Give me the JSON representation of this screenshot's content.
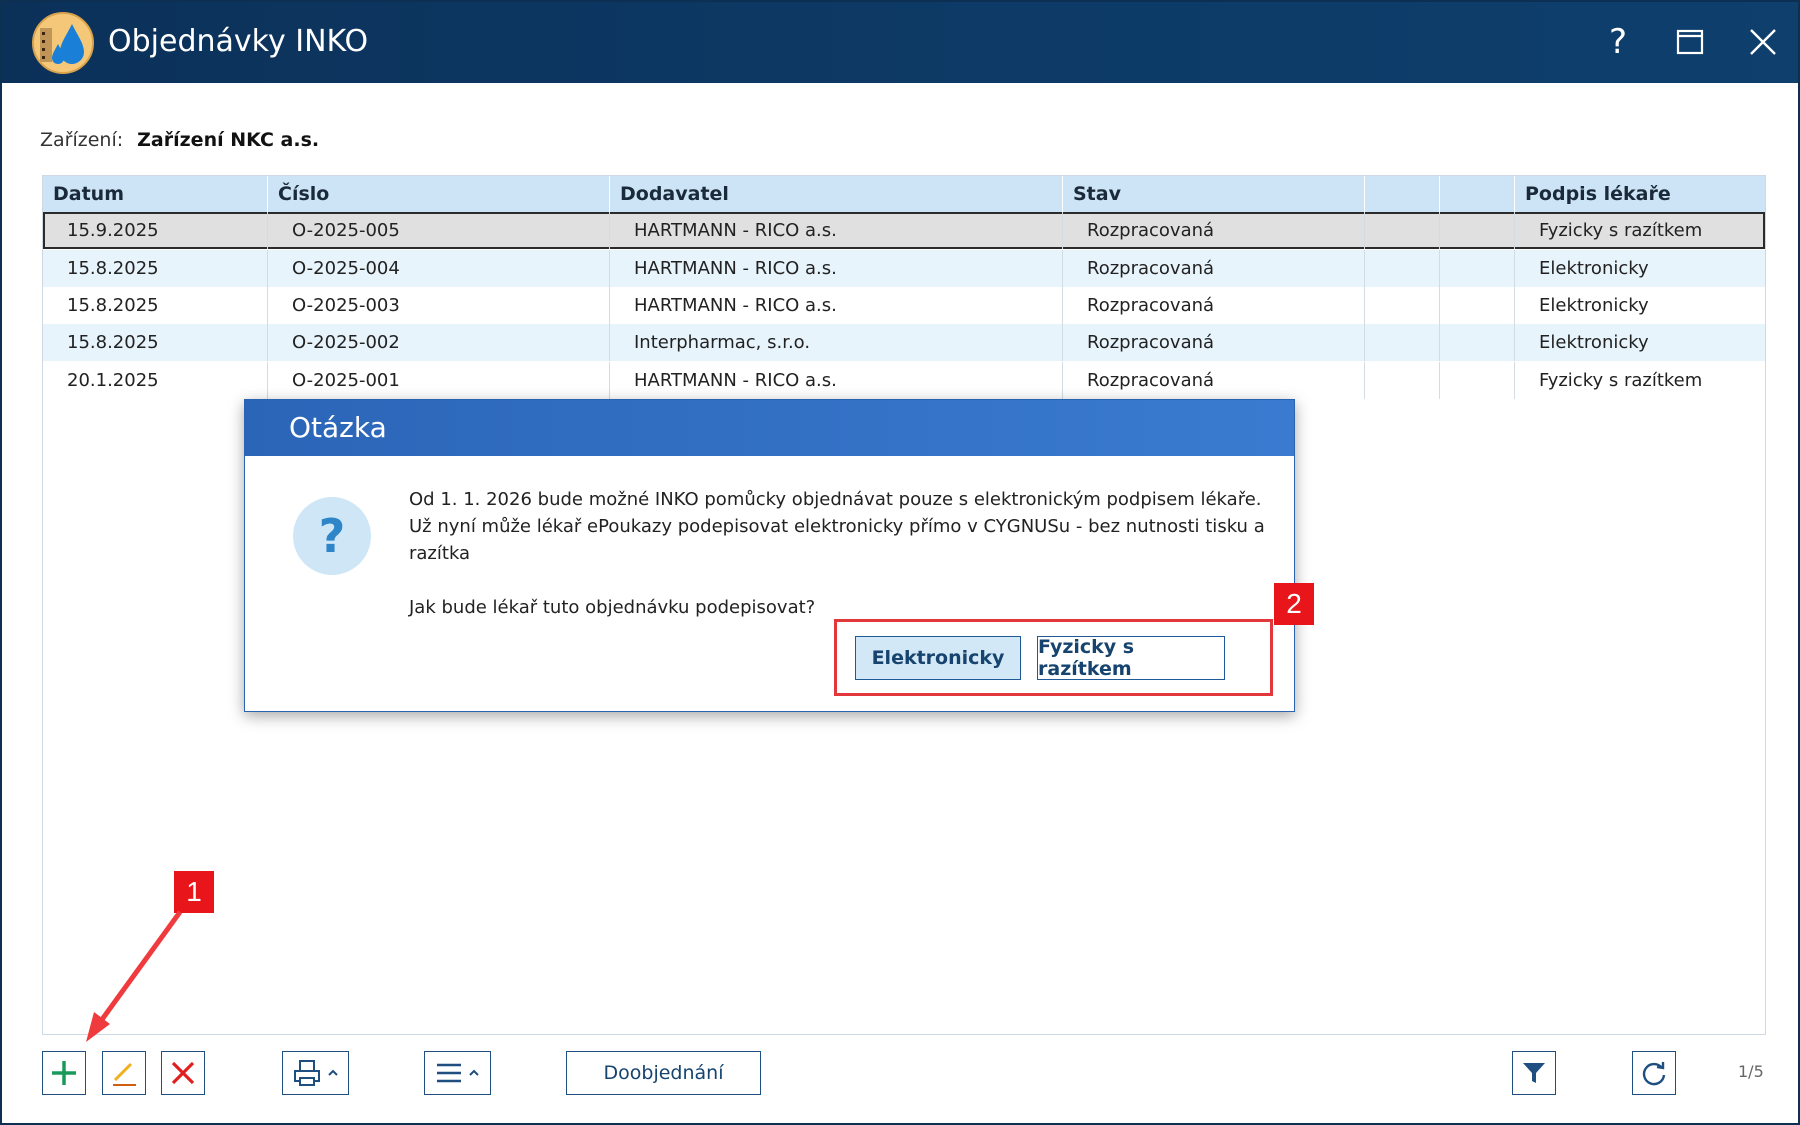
{
  "window": {
    "title": "Objednávky INKO",
    "logo_icon": "drops-app-icon",
    "help_label": "?"
  },
  "facility": {
    "label": "Zařízení:",
    "value": "Zařízení NKC a.s."
  },
  "grid": {
    "columns": [
      "Datum",
      "Číslo",
      "Dodavatel",
      "Stav",
      "",
      "",
      "Podpis lékaře"
    ],
    "rows": [
      {
        "datum": "15.9.2025",
        "cislo": "O-2025-005",
        "dodavatel": "HARTMANN - RICO a.s.",
        "stav": "Rozpracovaná",
        "podpis": "Fyzicky s razítkem",
        "selected": true
      },
      {
        "datum": "15.8.2025",
        "cislo": "O-2025-004",
        "dodavatel": "HARTMANN - RICO a.s.",
        "stav": "Rozpracovaná",
        "podpis": "Elektronicky"
      },
      {
        "datum": "15.8.2025",
        "cislo": "O-2025-003",
        "dodavatel": "HARTMANN - RICO a.s.",
        "stav": "Rozpracovaná",
        "podpis": "Elektronicky"
      },
      {
        "datum": "15.8.2025",
        "cislo": "O-2025-002",
        "dodavatel": "Interpharmac, s.r.o.",
        "stav": "Rozpracovaná",
        "podpis": "Elektronicky"
      },
      {
        "datum": "20.1.2025",
        "cislo": "O-2025-001",
        "dodavatel": "HARTMANN - RICO a.s.",
        "stav": "Rozpracovaná",
        "podpis": "Fyzicky s razítkem"
      }
    ]
  },
  "dialog": {
    "title": "Otázka",
    "icon_text": "?",
    "message_line1": "Od 1. 1. 2026 bude možné INKO pomůcky objednávat pouze s elektronickým podpisem lékaře.",
    "message_line2": "Už nyní může lékař ePoukazy podepisovat elektronicky přímo v CYGNUSu - bez nutnosti tisku a",
    "message_line3": "razítka",
    "question": "Jak bude lékař tuto objednávku podepisovat?",
    "btn_electronic": "Elektronicky",
    "btn_physical": "Fyzicky s razítkem"
  },
  "annotations": {
    "badge1": "1",
    "badge2": "2",
    "color": "#e8151b"
  },
  "toolbar": {
    "doobjednani": "Doobjednání",
    "pager": "1/5",
    "icons": [
      "plus-icon",
      "pencil-icon",
      "x-delete-icon",
      "printer-icon",
      "menu-lines-icon",
      "filter-icon",
      "refresh-icon"
    ]
  },
  "colors": {
    "titlebar": "#0b3159",
    "header_bg": "#cce4f5",
    "alt_row": "#e8f4fc",
    "dialog_title": "#2b65b8",
    "add_green": "#1a9a5a",
    "delete_red": "#e0201f"
  }
}
